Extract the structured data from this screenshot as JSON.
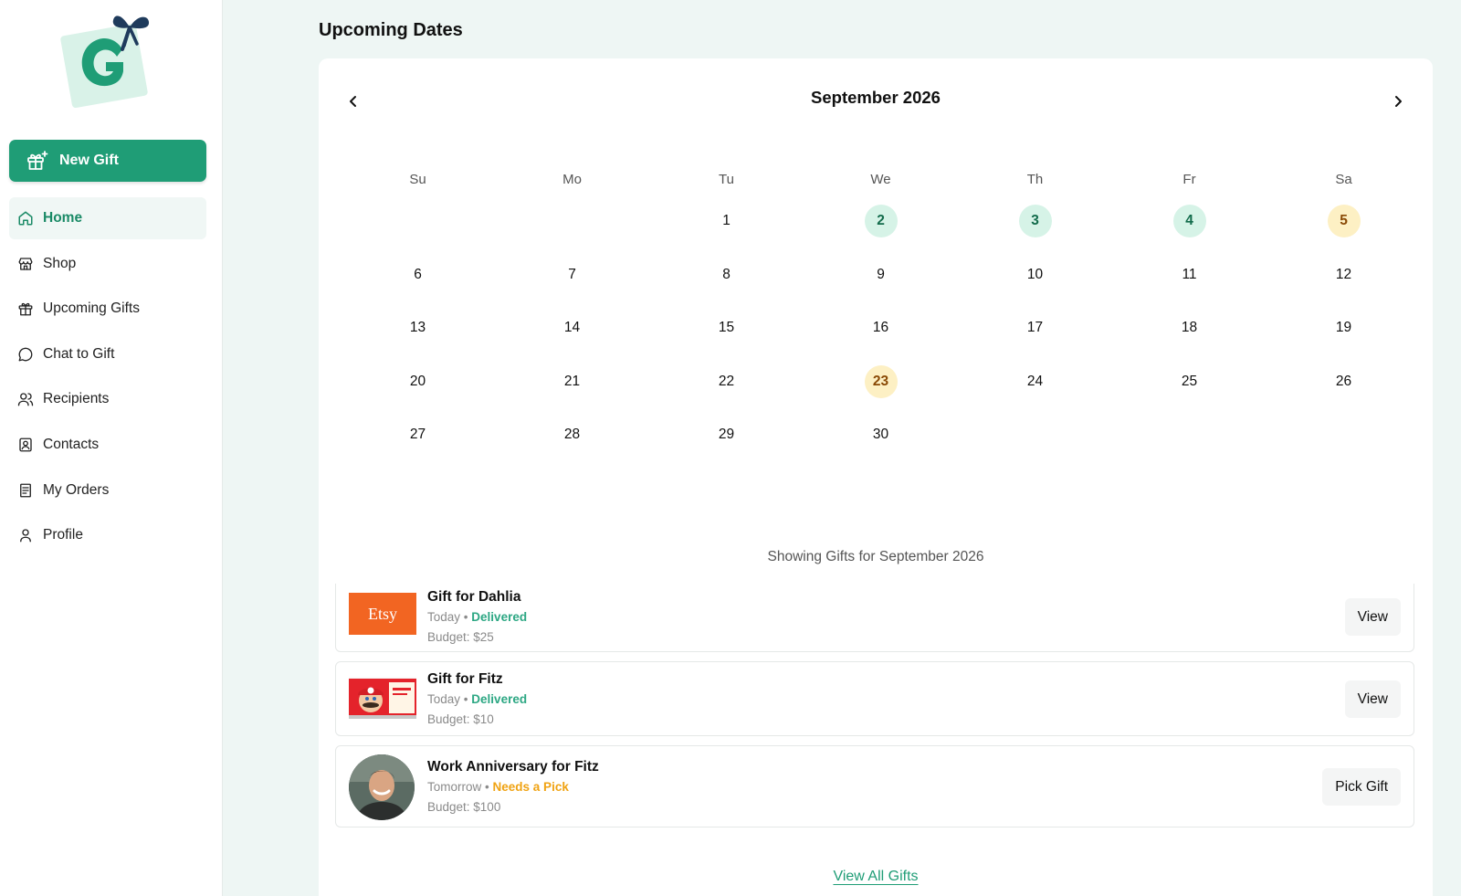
{
  "sidebar": {
    "new_gift_label": "New Gift",
    "items": [
      {
        "label": "Home",
        "icon": "home-icon",
        "active": true
      },
      {
        "label": "Shop",
        "icon": "store-icon"
      },
      {
        "label": "Upcoming Gifts",
        "icon": "gift-icon"
      },
      {
        "label": "Chat to Gift",
        "icon": "chat-bubble-icon"
      },
      {
        "label": "Recipients",
        "icon": "users-icon"
      },
      {
        "label": "Contacts",
        "icon": "contact-card-icon"
      },
      {
        "label": "My Orders",
        "icon": "receipt-icon"
      },
      {
        "label": "Profile",
        "icon": "user-icon"
      }
    ]
  },
  "page": {
    "title": "Upcoming Dates"
  },
  "calendar": {
    "month_label": "September 2026",
    "weekdays": [
      "Su",
      "Mo",
      "Tu",
      "We",
      "Th",
      "Fr",
      "Sa"
    ],
    "weeks": [
      [
        "",
        "",
        "1",
        "2",
        "3",
        "4",
        "5"
      ],
      [
        "6",
        "7",
        "8",
        "9",
        "10",
        "11",
        "12"
      ],
      [
        "13",
        "14",
        "15",
        "16",
        "17",
        "18",
        "19"
      ],
      [
        "20",
        "21",
        "22",
        "23",
        "24",
        "25",
        "26"
      ],
      [
        "27",
        "28",
        "29",
        "30",
        "",
        "",
        ""
      ]
    ],
    "highlights": {
      "2": "green",
      "3": "green",
      "4": "green",
      "5": "yellow",
      "23": "yellow"
    },
    "colors": {
      "green_bg": "#d6f3e7",
      "yellow_bg": "#fdf0c4"
    }
  },
  "gifts": {
    "showing_label": "Showing Gifts for September 2026",
    "items": [
      {
        "title": "Gift for Dahlia",
        "when": "Today",
        "status": "Delivered",
        "budget": "Budget: $25",
        "button": "View",
        "thumb_text": "Etsy"
      },
      {
        "title": "Gift for Fitz",
        "when": "Today",
        "status": "Delivered",
        "budget": "Budget: $10",
        "button": "View"
      },
      {
        "title": "Work Anniversary for Fitz",
        "when": "Tomorrow",
        "status": "Needs a Pick",
        "budget": "Budget: $100",
        "button": "Pick Gift"
      }
    ],
    "separator": "•",
    "view_all_label": "View All Gifts"
  },
  "theme": {
    "accent": "#1f9d76",
    "delivered": "#2ca783",
    "needs_pick": "#f0a313"
  }
}
